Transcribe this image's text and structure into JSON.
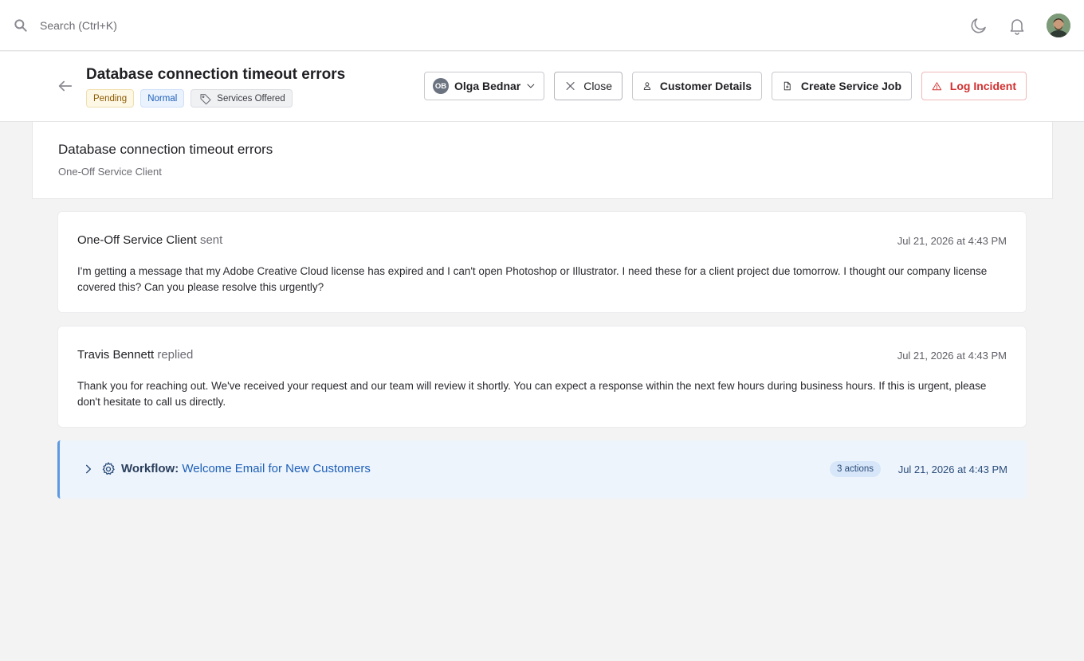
{
  "search": {
    "placeholder": "Search (Ctrl+K)"
  },
  "topbar": {
    "icons": [
      "moon-icon",
      "bell-icon"
    ],
    "avatar": "user-avatar"
  },
  "ticket": {
    "title": "Database connection timeout errors",
    "badges": {
      "status": "Pending",
      "priority": "Normal",
      "tag": "Services Offered"
    }
  },
  "actions": {
    "assignee_initials": "OB",
    "assignee_name": "Olga Bednar",
    "close_label": "Close",
    "customer_label": "Customer Details",
    "job_label": "Create Service Job",
    "incident_label": "Log Incident"
  },
  "summary": {
    "title": "Database connection timeout errors",
    "subtitle": "One-Off Service Client"
  },
  "messages": [
    {
      "author": "One-Off Service Client",
      "verb": "sent",
      "time": "Jul 21, 2026 at 4:43 PM",
      "body": "I'm getting a message that my Adobe Creative Cloud license has expired and I can't open Photoshop or Illustrator. I need these for a client project due tomorrow. I thought our company license covered this? Can you please resolve this urgently?"
    },
    {
      "author": "Travis Bennett",
      "verb": "replied",
      "time": "Jul 21, 2026 at 4:43 PM",
      "body": "Thank you for reaching out. We've received your request and our team will review it shortly. You can expect a response within the next few hours during business hours. If this is urgent, please don't hesitate to call us directly."
    }
  ],
  "workflow": {
    "label": "Workflow:",
    "name": "Welcome Email for New Customers",
    "count": "3 actions",
    "time": "Jul 21, 2026 at 4:43 PM"
  },
  "colors": {
    "accent_blue": "#1d5fb8",
    "danger_red": "#d32f2f",
    "pending_bg": "#fdf7e6",
    "workflow_bg": "#edf4fc"
  }
}
